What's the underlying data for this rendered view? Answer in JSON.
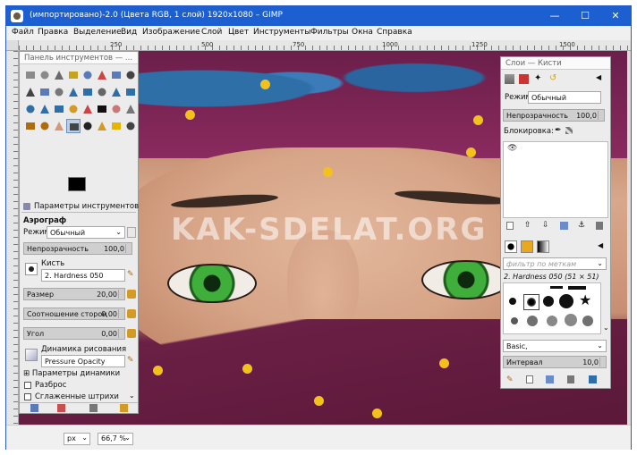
{
  "window": {
    "title": "(импортировано)-2.0 (Цвета RGB, 1 слой) 1920x1080 – GIMP",
    "minimize_icon": "minimize-icon",
    "maximize_icon": "maximize-icon",
    "close_icon": "close-icon"
  },
  "menu": [
    "Файл",
    "Правка",
    "Выделение",
    "Вид",
    "Изображение",
    "Слой",
    "Цвет",
    "Инструменты",
    "Фильтры",
    "Окна",
    "Справка"
  ],
  "ruler": {
    "labels": [
      "250",
      "500",
      "750",
      "1000",
      "1250",
      "1500"
    ]
  },
  "canvas": {
    "watermark": "KAK-SDELAT.ORG"
  },
  "toolbox": {
    "title": "Панель инструментов — ...",
    "tool_options_tab": "Параметры инструментов",
    "tool_name": "Аэрограф",
    "mode_label": "Режим:",
    "mode_value": "Обычный",
    "opacity_label": "Непрозрачность",
    "opacity_value": "100,0",
    "opacity_fraction": 1.0,
    "brush_label": "Кисть",
    "brush_value": "2. Hardness 050",
    "size_label": "Размер",
    "size_value": "20,00",
    "aspect_label": "Соотношение сторон",
    "aspect_value": "0,00",
    "angle_label": "Угол",
    "angle_value": "0,00",
    "dynamics_label": "Динамика рисования",
    "dynamics_value": "Pressure Opacity",
    "dynamics_options": "Параметры динамики",
    "scatter_label": "Разброс",
    "smooth_label": "Сглаженные штрихи"
  },
  "layers": {
    "title": "Слои — Кисти",
    "mode_label": "Режим:",
    "mode_value": "Обычный",
    "opacity_label": "Непрозрачность",
    "opacity_value": "100,0",
    "opacity_fraction": 1.0,
    "lock_label": "Блокировка:",
    "filter_placeholder": "фильтр по меткам",
    "brush_name": "2. Hardness 050 (51 × 51)",
    "preset_value": "Basic,",
    "interval_label": "Интервал",
    "interval_value": "10,0"
  },
  "status": {
    "unit": "px",
    "zoom": "66,7 %"
  },
  "colors": {
    "accent": "#1b5fd1",
    "orange": "#d49b24",
    "panel": "#ececec",
    "dot": "#f2c21a"
  }
}
